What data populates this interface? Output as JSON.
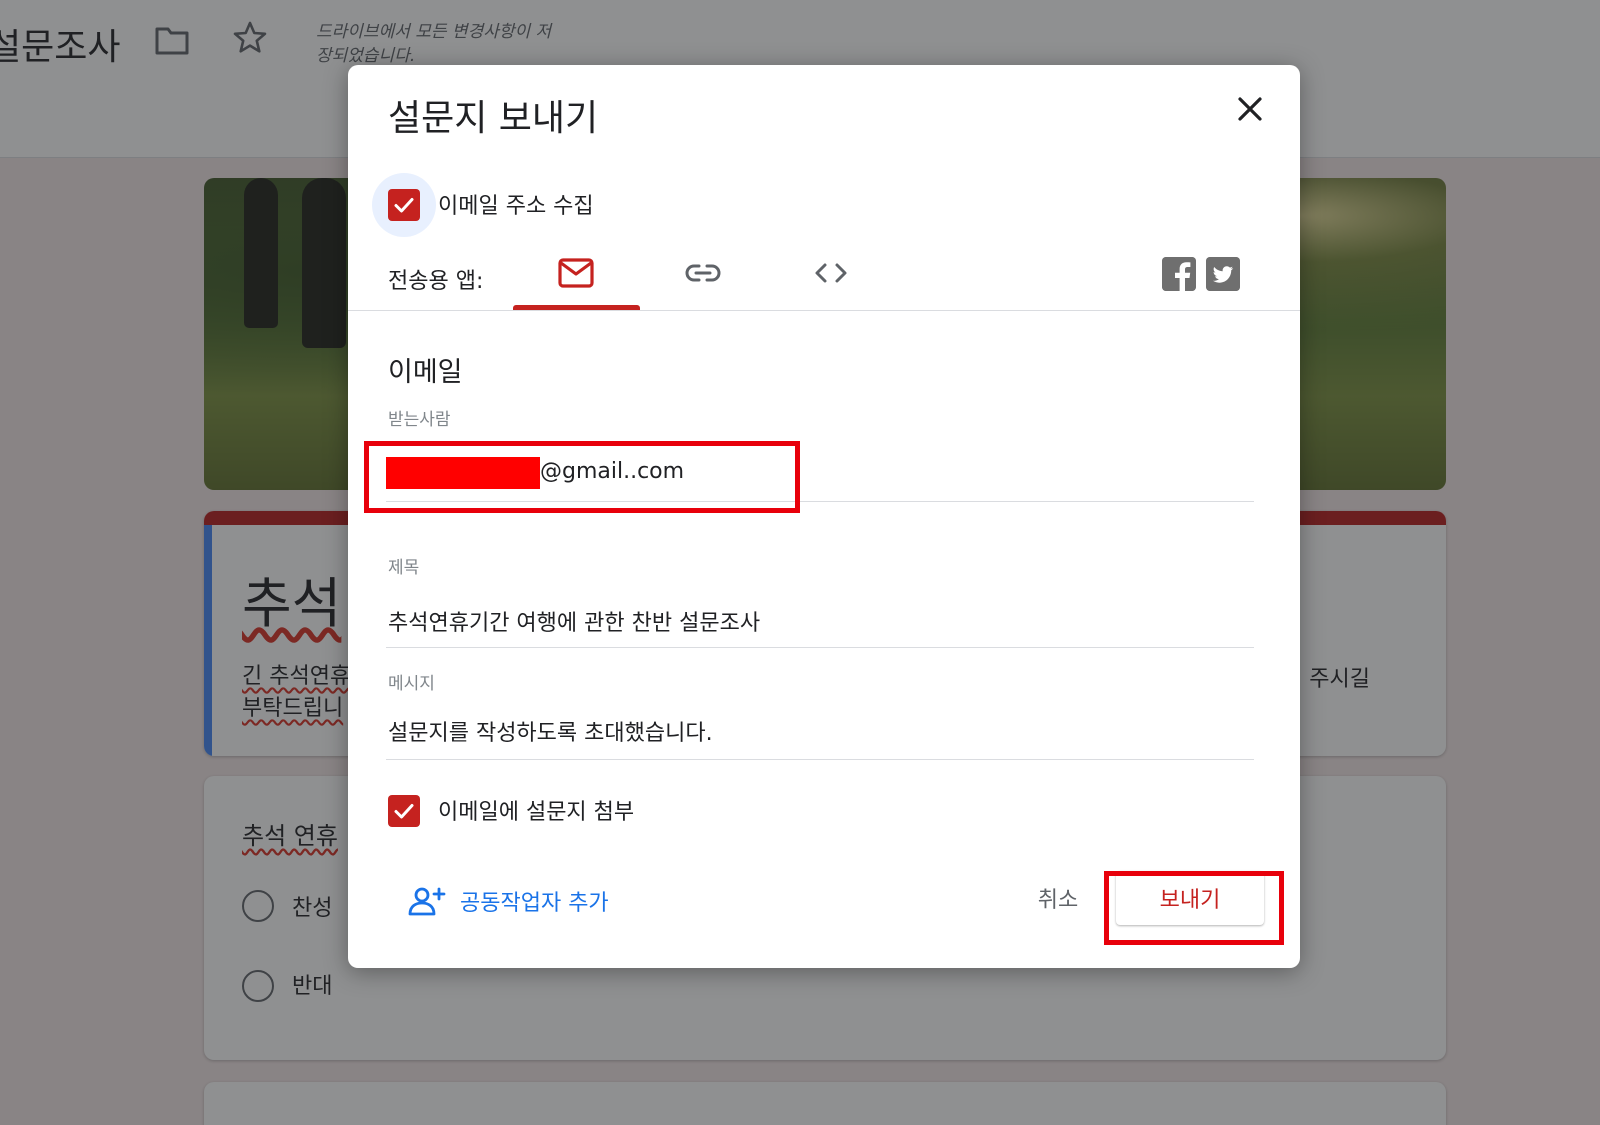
{
  "app": {
    "doc_title": "설문조사",
    "save_status": "드라이브에서 모든 변경사항이 저장되었습니다."
  },
  "form_bg": {
    "title_partial": "추석",
    "desc_line1_partial": "긴 추석연휴",
    "desc_line2_partial": "부탁드립니",
    "desc_right_partial": "여 주시길",
    "question_partial": "추석 연휴",
    "options": [
      "찬성",
      "반대"
    ]
  },
  "dialog": {
    "title": "설문지 보내기",
    "collect_email_label": "이메일 주소 수집",
    "send_via_label": "전송용 앱:",
    "tabs": [
      {
        "icon": "email-icon",
        "active": true
      },
      {
        "icon": "link-icon",
        "active": false
      },
      {
        "icon": "embed-code-icon",
        "active": false
      }
    ],
    "social": [
      "facebook-icon",
      "twitter-icon"
    ],
    "section_title": "이메일",
    "to": {
      "label": "받는사람",
      "value_suffix": "@gmail..com"
    },
    "subject": {
      "label": "제목",
      "value": "추석연휴기간 여행에 관한 찬반 설문조사"
    },
    "message": {
      "label": "메시지",
      "value": "설문지를 작성하도록 초대했습니다."
    },
    "include_form_label": "이메일에 설문지 첨부",
    "add_collaborators_label": "공동작업자 추가",
    "cancel_label": "취소",
    "send_label": "보내기"
  },
  "colors": {
    "theme_red": "#c5221f",
    "highlight_red": "#e8000b",
    "link_blue": "#1a73e8",
    "accent_blue": "#4285f4"
  }
}
